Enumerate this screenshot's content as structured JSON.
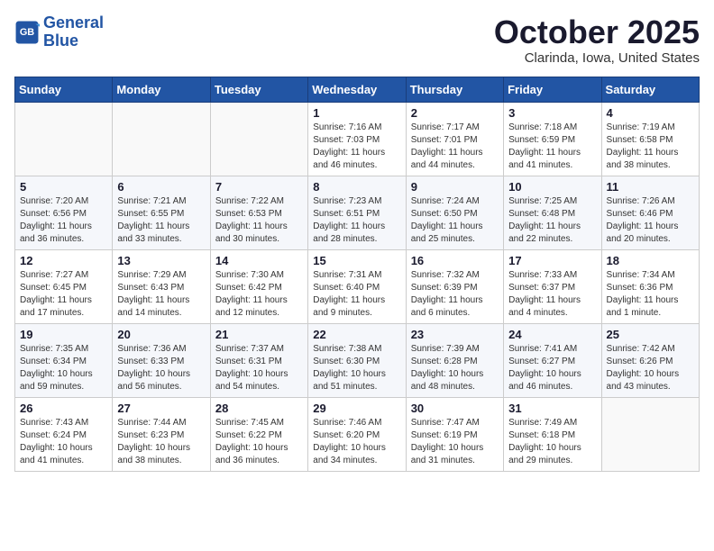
{
  "header": {
    "logo_line1": "General",
    "logo_line2": "Blue",
    "month_title": "October 2025",
    "subtitle": "Clarinda, Iowa, United States"
  },
  "weekdays": [
    "Sunday",
    "Monday",
    "Tuesday",
    "Wednesday",
    "Thursday",
    "Friday",
    "Saturday"
  ],
  "weeks": [
    [
      {
        "day": "",
        "info": ""
      },
      {
        "day": "",
        "info": ""
      },
      {
        "day": "",
        "info": ""
      },
      {
        "day": "1",
        "info": "Sunrise: 7:16 AM\nSunset: 7:03 PM\nDaylight: 11 hours\nand 46 minutes."
      },
      {
        "day": "2",
        "info": "Sunrise: 7:17 AM\nSunset: 7:01 PM\nDaylight: 11 hours\nand 44 minutes."
      },
      {
        "day": "3",
        "info": "Sunrise: 7:18 AM\nSunset: 6:59 PM\nDaylight: 11 hours\nand 41 minutes."
      },
      {
        "day": "4",
        "info": "Sunrise: 7:19 AM\nSunset: 6:58 PM\nDaylight: 11 hours\nand 38 minutes."
      }
    ],
    [
      {
        "day": "5",
        "info": "Sunrise: 7:20 AM\nSunset: 6:56 PM\nDaylight: 11 hours\nand 36 minutes."
      },
      {
        "day": "6",
        "info": "Sunrise: 7:21 AM\nSunset: 6:55 PM\nDaylight: 11 hours\nand 33 minutes."
      },
      {
        "day": "7",
        "info": "Sunrise: 7:22 AM\nSunset: 6:53 PM\nDaylight: 11 hours\nand 30 minutes."
      },
      {
        "day": "8",
        "info": "Sunrise: 7:23 AM\nSunset: 6:51 PM\nDaylight: 11 hours\nand 28 minutes."
      },
      {
        "day": "9",
        "info": "Sunrise: 7:24 AM\nSunset: 6:50 PM\nDaylight: 11 hours\nand 25 minutes."
      },
      {
        "day": "10",
        "info": "Sunrise: 7:25 AM\nSunset: 6:48 PM\nDaylight: 11 hours\nand 22 minutes."
      },
      {
        "day": "11",
        "info": "Sunrise: 7:26 AM\nSunset: 6:46 PM\nDaylight: 11 hours\nand 20 minutes."
      }
    ],
    [
      {
        "day": "12",
        "info": "Sunrise: 7:27 AM\nSunset: 6:45 PM\nDaylight: 11 hours\nand 17 minutes."
      },
      {
        "day": "13",
        "info": "Sunrise: 7:29 AM\nSunset: 6:43 PM\nDaylight: 11 hours\nand 14 minutes."
      },
      {
        "day": "14",
        "info": "Sunrise: 7:30 AM\nSunset: 6:42 PM\nDaylight: 11 hours\nand 12 minutes."
      },
      {
        "day": "15",
        "info": "Sunrise: 7:31 AM\nSunset: 6:40 PM\nDaylight: 11 hours\nand 9 minutes."
      },
      {
        "day": "16",
        "info": "Sunrise: 7:32 AM\nSunset: 6:39 PM\nDaylight: 11 hours\nand 6 minutes."
      },
      {
        "day": "17",
        "info": "Sunrise: 7:33 AM\nSunset: 6:37 PM\nDaylight: 11 hours\nand 4 minutes."
      },
      {
        "day": "18",
        "info": "Sunrise: 7:34 AM\nSunset: 6:36 PM\nDaylight: 11 hours\nand 1 minute."
      }
    ],
    [
      {
        "day": "19",
        "info": "Sunrise: 7:35 AM\nSunset: 6:34 PM\nDaylight: 10 hours\nand 59 minutes."
      },
      {
        "day": "20",
        "info": "Sunrise: 7:36 AM\nSunset: 6:33 PM\nDaylight: 10 hours\nand 56 minutes."
      },
      {
        "day": "21",
        "info": "Sunrise: 7:37 AM\nSunset: 6:31 PM\nDaylight: 10 hours\nand 54 minutes."
      },
      {
        "day": "22",
        "info": "Sunrise: 7:38 AM\nSunset: 6:30 PM\nDaylight: 10 hours\nand 51 minutes."
      },
      {
        "day": "23",
        "info": "Sunrise: 7:39 AM\nSunset: 6:28 PM\nDaylight: 10 hours\nand 48 minutes."
      },
      {
        "day": "24",
        "info": "Sunrise: 7:41 AM\nSunset: 6:27 PM\nDaylight: 10 hours\nand 46 minutes."
      },
      {
        "day": "25",
        "info": "Sunrise: 7:42 AM\nSunset: 6:26 PM\nDaylight: 10 hours\nand 43 minutes."
      }
    ],
    [
      {
        "day": "26",
        "info": "Sunrise: 7:43 AM\nSunset: 6:24 PM\nDaylight: 10 hours\nand 41 minutes."
      },
      {
        "day": "27",
        "info": "Sunrise: 7:44 AM\nSunset: 6:23 PM\nDaylight: 10 hours\nand 38 minutes."
      },
      {
        "day": "28",
        "info": "Sunrise: 7:45 AM\nSunset: 6:22 PM\nDaylight: 10 hours\nand 36 minutes."
      },
      {
        "day": "29",
        "info": "Sunrise: 7:46 AM\nSunset: 6:20 PM\nDaylight: 10 hours\nand 34 minutes."
      },
      {
        "day": "30",
        "info": "Sunrise: 7:47 AM\nSunset: 6:19 PM\nDaylight: 10 hours\nand 31 minutes."
      },
      {
        "day": "31",
        "info": "Sunrise: 7:49 AM\nSunset: 6:18 PM\nDaylight: 10 hours\nand 29 minutes."
      },
      {
        "day": "",
        "info": ""
      }
    ]
  ]
}
